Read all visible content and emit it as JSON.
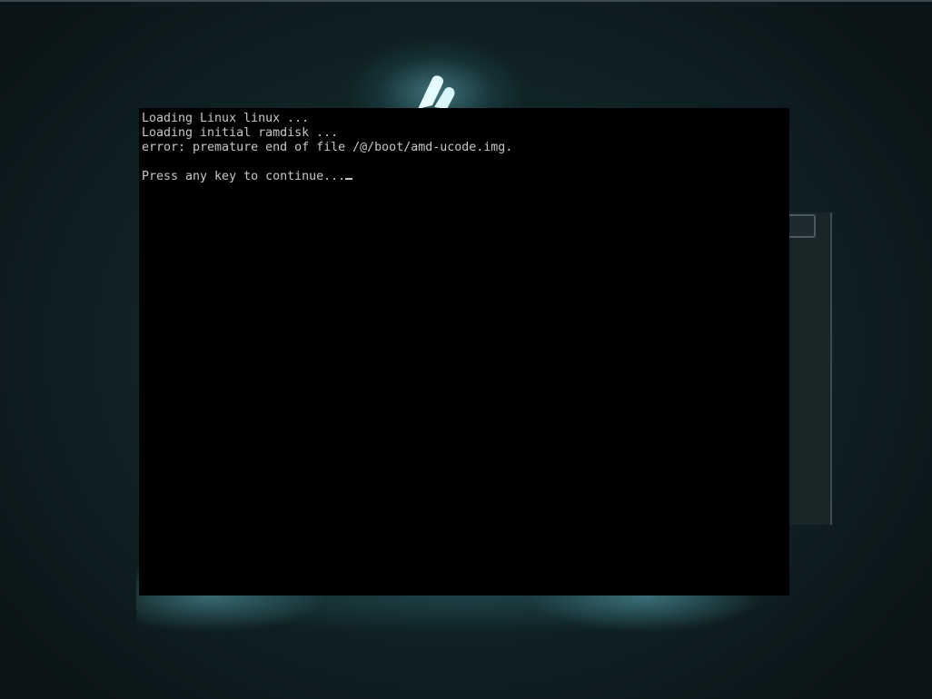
{
  "console": {
    "lines": [
      "Loading Linux linux ...",
      "Loading initial ramdisk ...",
      "error: premature end of file /@/boot/amd-ucode.img.",
      "",
      "Press any key to continue..."
    ]
  },
  "icons": {
    "background_logo": "distro-logo-icon",
    "cursor": "text-cursor-icon"
  },
  "colors": {
    "background_dark": "#0b1517",
    "background_glow": "#1f4e54",
    "terminal_bg": "#000000",
    "terminal_text": "#c8c8c8"
  }
}
